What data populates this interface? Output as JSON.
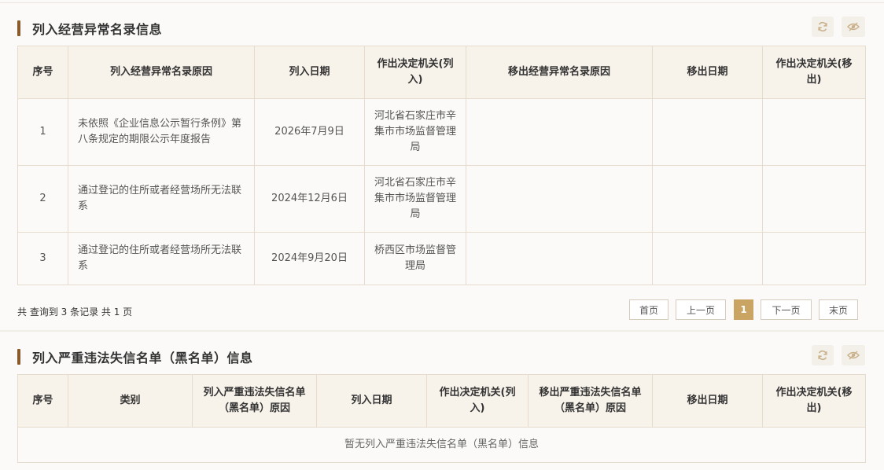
{
  "colors": {
    "accent": "#8a5a2b",
    "page_active": "#c9a463",
    "header_bg": "#f7f2ea",
    "border": "#e6dccd"
  },
  "abnormal": {
    "title": "列入经营异常名录信息",
    "columns": [
      "序号",
      "列入经营异常名录原因",
      "列入日期",
      "作出决定机关(列入)",
      "移出经营异常名录原因",
      "移出日期",
      "作出决定机关(移出)"
    ],
    "rows": [
      {
        "no": "1",
        "reason": "未依照《企业信息公示暂行条例》第八条规定的期限公示年度报告",
        "date": "2026年7月9日",
        "authority": "河北省石家庄市辛集市市场监督管理局",
        "remove_reason": "",
        "remove_date": "",
        "remove_authority": ""
      },
      {
        "no": "2",
        "reason": "通过登记的住所或者经营场所无法联系",
        "date": "2024年12月6日",
        "authority": "河北省石家庄市辛集市市场监督管理局",
        "remove_reason": "",
        "remove_date": "",
        "remove_authority": ""
      },
      {
        "no": "3",
        "reason": "通过登记的住所或者经营场所无法联系",
        "date": "2024年9月20日",
        "authority": "桥西区市场监督管理局",
        "remove_reason": "",
        "remove_date": "",
        "remove_authority": ""
      }
    ],
    "summary": "共 查询到 3 条记录 共 1 页",
    "pager": {
      "first": "首页",
      "prev": "上一页",
      "current": "1",
      "next": "下一页",
      "last": "末页"
    }
  },
  "blacklist": {
    "title": "列入严重违法失信名单（黑名单）信息",
    "columns": [
      "序号",
      "类别",
      "列入严重违法失信名单（黑名单）原因",
      "列入日期",
      "作出决定机关(列入)",
      "移出严重违法失信名单（黑名单）原因",
      "移出日期",
      "作出决定机关(移出)"
    ],
    "empty": "暂无列入严重违法失信名单（黑名单）信息"
  },
  "icons": {
    "refresh": "refresh-icon",
    "hide": "eye-hide-icon"
  }
}
